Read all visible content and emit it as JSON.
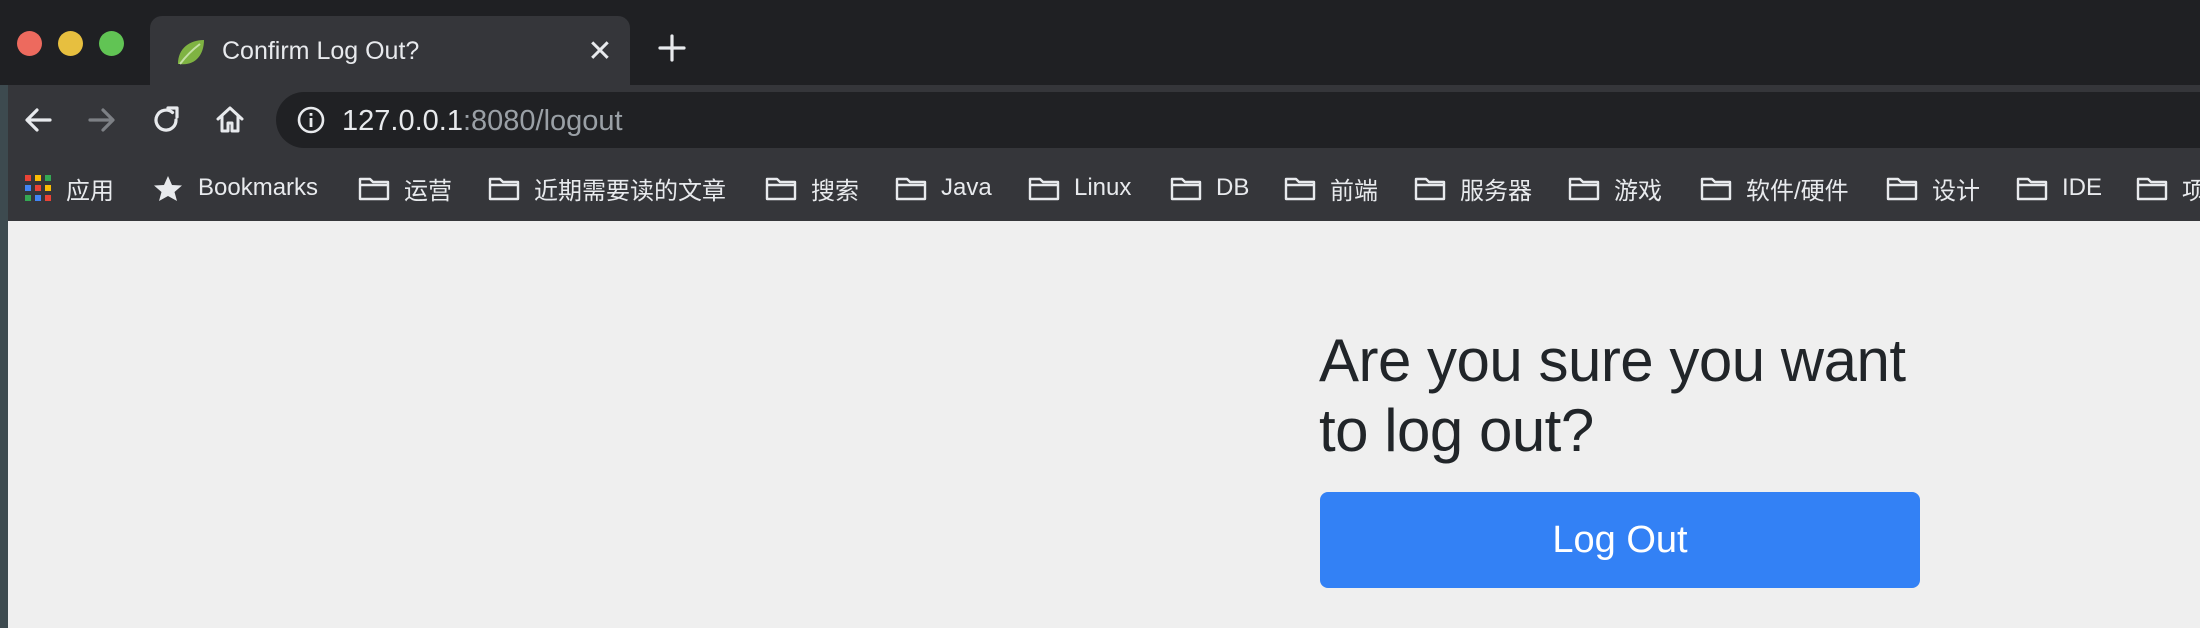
{
  "browser": {
    "tab": {
      "title": "Confirm Log Out?",
      "close_glyph": "✕",
      "favicon": "spring-leaf-icon"
    },
    "address_bar": {
      "host": "127.0.0.1",
      "rest": ":8080/logout"
    },
    "bookmarks": {
      "apps_label": "应用",
      "items": [
        {
          "label": "Bookmarks",
          "icon": "star-icon"
        },
        {
          "label": "运营",
          "icon": "folder-icon"
        },
        {
          "label": "近期需要读的文章",
          "icon": "folder-icon"
        },
        {
          "label": "搜索",
          "icon": "folder-icon"
        },
        {
          "label": "Java",
          "icon": "folder-icon"
        },
        {
          "label": "Linux",
          "icon": "folder-icon"
        },
        {
          "label": "DB",
          "icon": "folder-icon"
        },
        {
          "label": "前端",
          "icon": "folder-icon"
        },
        {
          "label": "服务器",
          "icon": "folder-icon"
        },
        {
          "label": "游戏",
          "icon": "folder-icon"
        },
        {
          "label": "软件/硬件",
          "icon": "folder-icon"
        },
        {
          "label": "设计",
          "icon": "folder-icon"
        },
        {
          "label": "IDE",
          "icon": "folder-icon"
        },
        {
          "label": "项",
          "icon": "folder-icon"
        }
      ]
    }
  },
  "page": {
    "heading": "Are you sure you want to log out?",
    "button_label": "Log Out",
    "button_color": "#3381f5"
  }
}
